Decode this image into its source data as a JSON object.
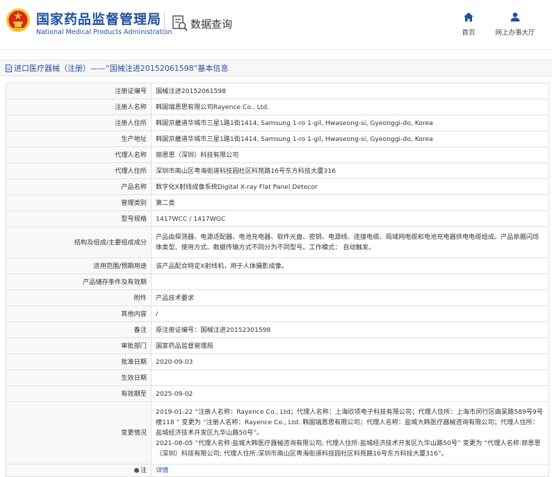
{
  "header": {
    "org_cn": "国家药品监督管理局",
    "org_en": "National Medical Products Administration",
    "query_label": "数据查询",
    "nav": {
      "home_label": "首页",
      "office_label": "网上办事大厅"
    }
  },
  "title": "进口医疗器械（注册）——“国械注进20152061598”基本信息",
  "rows": [
    {
      "label": "注册证编号",
      "value": "国械注进20152061598"
    },
    {
      "label": "注册人名称",
      "value": "韩国瑞恩思有限公司Rayence Co., Ltd."
    },
    {
      "label": "注册人住所",
      "value": "韩国京畿道华城市三星1路1街1414, Samsung 1-ro 1-gil, Hwaseong-si, Gyeonggi-do, Korea"
    },
    {
      "label": "生产地址",
      "value": "韩国京畿道华城市三星1路1街1414, Samsung 1-ro 1-gil, Hwaseong-si, Gyeonggi-do, Korea"
    },
    {
      "label": "代理人名称",
      "value": "丽恩思（深圳）科技有限公司"
    },
    {
      "label": "代理人住所",
      "value": "深圳市南山区粤海街道科技园社区科苑路16号东方科技大厦316"
    },
    {
      "label": "产品名称",
      "value": "数字化X射线成像系统Digital X-ray Flat Panel Detecor"
    },
    {
      "label": "管理类别",
      "value": "第二类"
    },
    {
      "label": "型号规格",
      "value": "1417WCC / 1417WGC"
    },
    {
      "label": "结构及组成/主要组成成分",
      "value": "产品由探测器、电源适配器、电池充电器、软件光盘、密钥、电源线、连接电缆、局域网电缆和电池充电器供电电缆组成。产品依据闪烁体类型、使用方式、数据传输方式不同分为不同型号。工作模式： 自动触发。"
    },
    {
      "label": "适用范围/预期用途",
      "value": "该产品配合特定X射线机，用于人体摄影成像。"
    },
    {
      "label": "产品储存条件及有效期",
      "value": ""
    },
    {
      "label": "附件",
      "value": "产品技术要求"
    },
    {
      "label": "其他内容",
      "value": "/"
    },
    {
      "label": "备注",
      "value": "原注册证编号：国械注进20152301598"
    },
    {
      "label": "审批部门",
      "value": "国家药品监督管理局"
    },
    {
      "label": "批准日期",
      "value": "2020-09-03"
    },
    {
      "label": "生效日期",
      "value": ""
    },
    {
      "label": "有效期至",
      "value": "2025-09-02"
    },
    {
      "label": "变更情况",
      "value": ""
    }
  ],
  "change_history": [
    "2019-01-22  “注册人名称：Rayence Co., Ltd；代理人名称：上海欣项电子科技有限公司；代理人住所：上海市闵行区曲吴路589号9号楼118 ” 变更为 “注册人名称：Rayence Co., Ltd. 韩国瑞恩思有限公司；代理人名称：盐城大韩医疗器械咨询有限公司；代理人住所：盐城经济技术开发区九华山路50号”。",
    "2021-08-05  “代理人名称:盐城大韩医疗器械咨询有限公司; 代理人住所:盐城经济技术开发区九华山路50号” 变更为 “代理人名称:丽恩思（深圳）科技有限公司; 代理人住所:深圳市南山区粤海街道科技园社区科苑路16号东方科技大厦316”。"
  ],
  "note": {
    "label": "注",
    "link": "详情"
  },
  "colors": {
    "brand_blue": "#1f4fa3",
    "emblem_red": "#d7261e",
    "emblem_gold": "#f4c430"
  },
  "icons": [
    "national-emblem-icon",
    "data-query-icon",
    "home-icon",
    "user-icon",
    "document-icon"
  ]
}
